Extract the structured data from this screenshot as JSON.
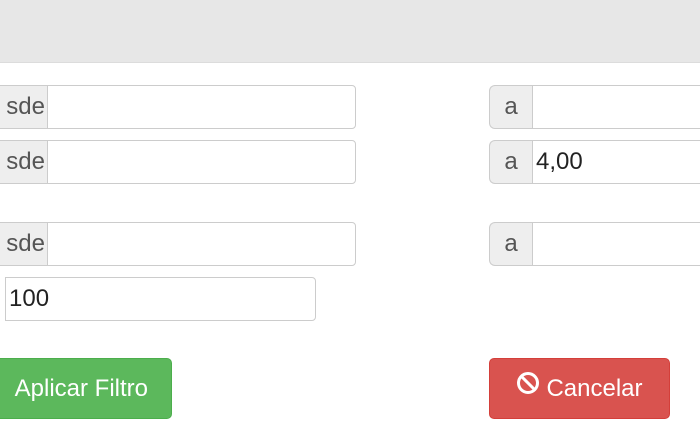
{
  "header": {},
  "filters": [
    {
      "from_label": "sde",
      "from_value": "",
      "to_label": "a",
      "to_value": ""
    },
    {
      "from_label": "sde",
      "from_value": "",
      "to_label": "a",
      "to_value": "4,00"
    },
    {
      "from_label": "sde",
      "from_value": "",
      "to_label": "a",
      "to_value": ""
    }
  ],
  "limit_value": "100",
  "buttons": {
    "apply_label": "Aplicar Filtro",
    "cancel_label": "Cancelar",
    "cancel_icon": "ban-icon"
  },
  "colors": {
    "apply": "#5cb85c",
    "cancel": "#d9534f",
    "header": "#e7e7e7"
  }
}
